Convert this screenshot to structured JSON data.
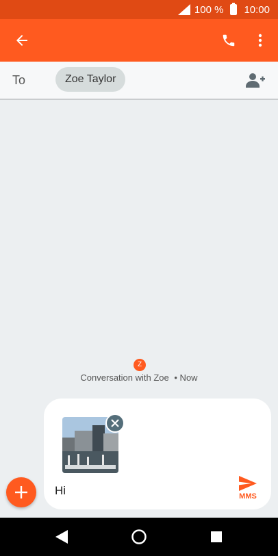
{
  "status_bar": {
    "battery_percent": "100 %",
    "time": "10:00",
    "icons": [
      "signal-icon",
      "battery-icon"
    ]
  },
  "app_bar": {
    "icons": [
      "back-arrow-icon",
      "phone-icon",
      "more-vert-icon"
    ]
  },
  "recipient": {
    "to_label": "To",
    "chip_name": "Zoe Taylor",
    "add_contact_icon": "add-person-icon"
  },
  "conversation": {
    "avatar_initial": "Z",
    "label": "Conversation with Zoe",
    "time": "• Now"
  },
  "composer": {
    "attachment_icon": "image-thumbnail",
    "remove_icon": "close-icon",
    "message_text": "Hi",
    "send_label": "MMS",
    "send_icon": "send-icon"
  },
  "fab": {
    "icon": "plus-icon"
  },
  "nav_bar": {
    "icons": [
      "back-triangle-icon",
      "home-circle-icon",
      "recents-square-icon"
    ]
  },
  "colors": {
    "status_bar": "#e04a14",
    "app_bar": "#ff5a1f",
    "accent": "#ff5a1f",
    "background": "#eceff1"
  }
}
